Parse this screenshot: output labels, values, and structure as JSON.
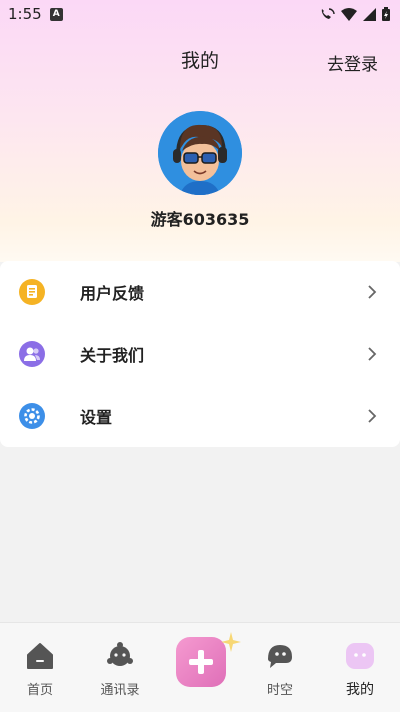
{
  "status_bar": {
    "time": "1:55",
    "badge": "A"
  },
  "header": {
    "title": "我的",
    "login_label": "去登录"
  },
  "profile": {
    "username": "游客603635"
  },
  "menu": [
    {
      "label": "用户反馈",
      "icon": "feedback-icon",
      "color": "#f5b324"
    },
    {
      "label": "关于我们",
      "icon": "about-us-icon",
      "color": "#8b6ee6"
    },
    {
      "label": "设置",
      "icon": "settings-icon",
      "color": "#3d8fe8"
    }
  ],
  "bottom_nav": [
    {
      "label": "首页",
      "icon": "home-icon"
    },
    {
      "label": "通讯录",
      "icon": "contacts-icon"
    },
    {
      "label": "",
      "icon": "plus-icon"
    },
    {
      "label": "时空",
      "icon": "ghost-icon"
    },
    {
      "label": "我的",
      "icon": "mine-icon",
      "active": true
    }
  ],
  "colors": {
    "accent": "#e07ab9",
    "active_tab": "#ecc6f4"
  }
}
